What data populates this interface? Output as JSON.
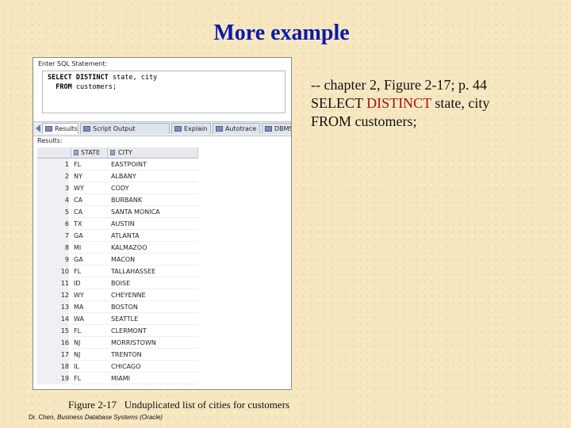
{
  "slide": {
    "title": "More example",
    "notes": {
      "line1": "-- chapter 2, Figure 2-17; p. 44",
      "line2_a": "SELECT ",
      "line2_kw": "DISTINCT",
      "line2_b": " state, city",
      "line3": "FROM customers;"
    },
    "caption": "Figure 2-17   Unduplicated list of cities for customers",
    "footer_author": "Dr. Chen, ",
    "footer_book": "Business Database Systems (Oracle)"
  },
  "colors": {
    "title": "#0b1aa8",
    "keyword": "#a3121a",
    "background": "#f7e7c1"
  },
  "screenshot": {
    "pane_label": "Enter SQL Statement:",
    "editor": {
      "line1_kw": "SELECT DISTINCT",
      "line1_rest": " state, city",
      "line2_kw": "FROM",
      "line2_rest": " customers;"
    },
    "tabs": [
      {
        "label": "Results",
        "icon": "results-icon"
      },
      {
        "label": "Script Output",
        "icon": "script-output-icon"
      },
      {
        "label": "Explain",
        "icon": "explain-icon"
      },
      {
        "label": "Autotrace",
        "icon": "autotrace-icon"
      },
      {
        "label": "DBMS Output",
        "icon": "dbms-output-icon"
      }
    ],
    "results_label": "Results:",
    "columns": [
      "STATE",
      "CITY"
    ],
    "rows": [
      {
        "n": "1",
        "state": "FL",
        "city": "EASTPOINT"
      },
      {
        "n": "2",
        "state": "NY",
        "city": "ALBANY"
      },
      {
        "n": "3",
        "state": "WY",
        "city": "CODY"
      },
      {
        "n": "4",
        "state": "CA",
        "city": "BURBANK"
      },
      {
        "n": "5",
        "state": "CA",
        "city": "SANTA MONICA"
      },
      {
        "n": "6",
        "state": "TX",
        "city": "AUSTIN"
      },
      {
        "n": "7",
        "state": "GA",
        "city": "ATLANTA"
      },
      {
        "n": "8",
        "state": "MI",
        "city": "KALMAZOO"
      },
      {
        "n": "9",
        "state": "GA",
        "city": "MACON"
      },
      {
        "n": "10",
        "state": "FL",
        "city": "TALLAHASSEE"
      },
      {
        "n": "11",
        "state": "ID",
        "city": "BOISE"
      },
      {
        "n": "12",
        "state": "WY",
        "city": "CHEYENNE"
      },
      {
        "n": "13",
        "state": "MA",
        "city": "BOSTON"
      },
      {
        "n": "14",
        "state": "WA",
        "city": "SEATTLE"
      },
      {
        "n": "15",
        "state": "FL",
        "city": "CLERMONT"
      },
      {
        "n": "16",
        "state": "NJ",
        "city": "MORRISTOWN"
      },
      {
        "n": "17",
        "state": "NJ",
        "city": "TRENTON"
      },
      {
        "n": "18",
        "state": "IL",
        "city": "CHICAGO"
      },
      {
        "n": "19",
        "state": "FL",
        "city": "MIAMI"
      }
    ]
  }
}
